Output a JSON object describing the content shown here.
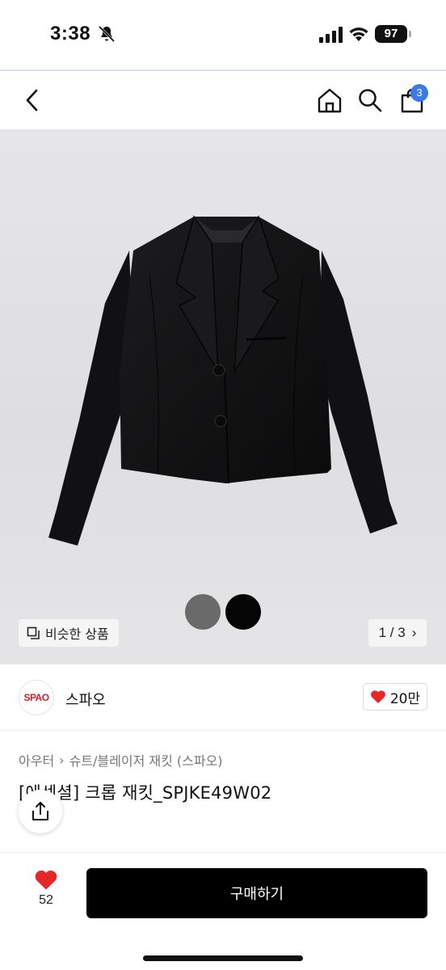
{
  "status_bar": {
    "time": "3:38",
    "battery": "97",
    "icons": [
      "bell-off-icon",
      "signal-icon",
      "wifi-icon",
      "battery-icon"
    ]
  },
  "nav": {
    "back_icon": "chevron-left-icon",
    "home_icon": "home-icon",
    "search_icon": "search-icon",
    "bag_icon": "shopping-bag-icon",
    "cart_count": "3",
    "badge_color": "#3a7be8"
  },
  "gallery": {
    "image_subject": "black cropped jacket on gray background",
    "color_swatches": [
      "#6a6a6b",
      "#050505"
    ],
    "similar_label": "비슷한 상품",
    "page_current": "1",
    "page_total": "3",
    "page_separator": "/",
    "page_arrow": "›"
  },
  "brand": {
    "logo_text": "SPAO",
    "name": "스파오",
    "like_count": "20만",
    "logo_color": "#d4202a"
  },
  "product": {
    "breadcrumb": [
      "아우터",
      "슈트/블레이저 재킷 (스파오)"
    ],
    "breadcrumb_separator": "›",
    "title": "[에센셜] 크롭 재킷_SPJKE49W02"
  },
  "bottom": {
    "wish_count": "52",
    "buy_label": "구매하기",
    "heart_color": "#e52727"
  }
}
